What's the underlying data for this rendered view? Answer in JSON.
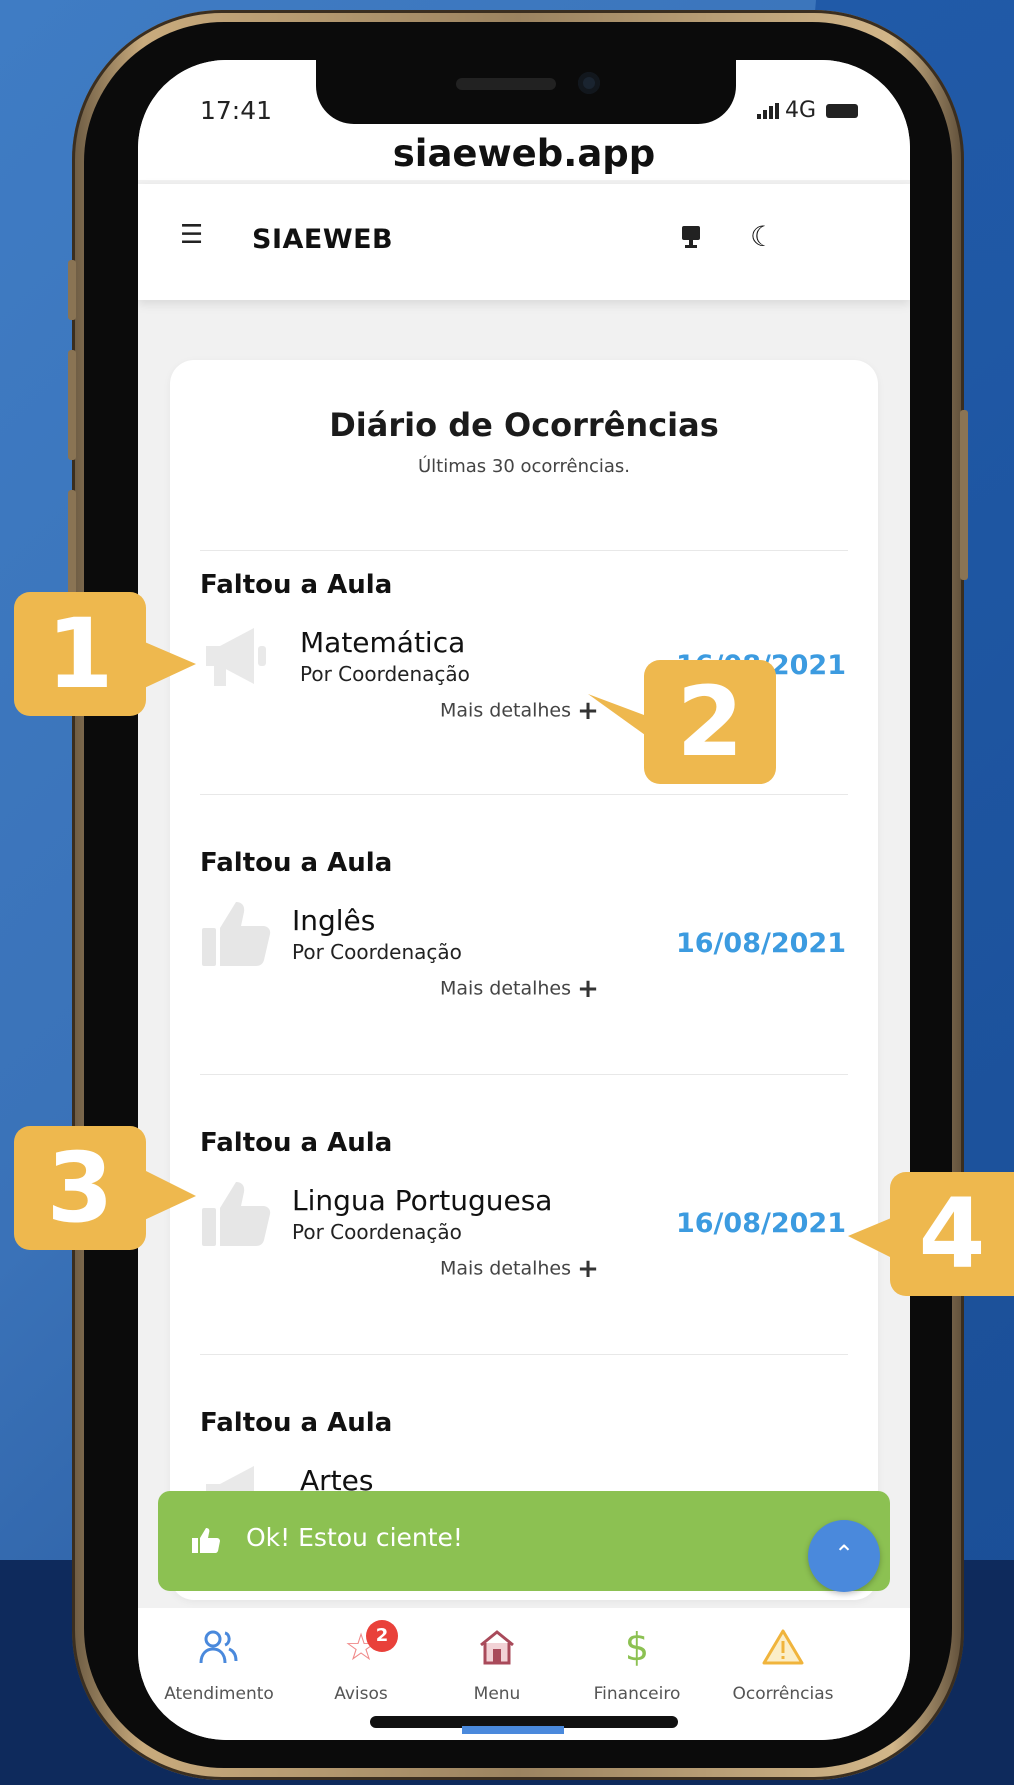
{
  "status_bar": {
    "time": "17:41",
    "network": "4G"
  },
  "browser": {
    "url": "siaeweb.app"
  },
  "app_bar": {
    "brand": "SIAEWEB",
    "menu_icon": "hamburger-menu-icon",
    "monitor_icon": "monitor-icon",
    "theme_icon": "moon-icon"
  },
  "page": {
    "title": "Diário de Ocorrências",
    "subtitle": "Últimas 30 ocorrências."
  },
  "occurrences": [
    {
      "type": "Faltou a Aula",
      "icon": "megaphone-icon",
      "subject": "Matemática",
      "by": "Por Coordenação",
      "date": "16/08/2021",
      "more": "Mais detalhes"
    },
    {
      "type": "Faltou a Aula",
      "icon": "thumbs-up-icon",
      "subject": "Inglês",
      "by": "Por Coordenação",
      "date": "16/08/2021",
      "more": "Mais detalhes"
    },
    {
      "type": "Faltou a Aula",
      "icon": "thumbs-up-icon",
      "subject": "Lingua Portuguesa",
      "by": "Por Coordenação",
      "date": "16/08/2021",
      "more": "Mais detalhes"
    },
    {
      "type": "Faltou a Aula",
      "icon": "megaphone-icon",
      "subject": "Artes",
      "by": "",
      "date": "",
      "more": ""
    }
  ],
  "ok_bar": {
    "label": "Ok! Estou ciente!",
    "color": "#8cc152"
  },
  "bottom_nav": [
    {
      "label": "Atendimento",
      "icon": "users-icon"
    },
    {
      "label": "Avisos",
      "icon": "star-icon",
      "badge": "2"
    },
    {
      "label": "Menu",
      "icon": "home-icon"
    },
    {
      "label": "Financeiro",
      "icon": "dollar-icon"
    },
    {
      "label": "Ocorrências",
      "icon": "warning-icon"
    }
  ],
  "markers": [
    "1",
    "2",
    "3",
    "4"
  ],
  "colors": {
    "accent": "#3c9be0",
    "marker": "#eeb84e",
    "fab": "#4a89dc",
    "badge": "#e9413a"
  }
}
